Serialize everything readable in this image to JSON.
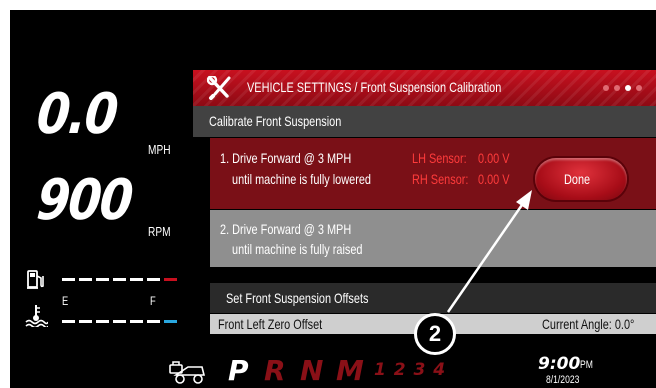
{
  "gauges": {
    "speed_value": "0.0",
    "speed_unit": "MPH",
    "rpm_value": "900",
    "rpm_unit": "RPM",
    "fuel_empty_label": "E",
    "fuel_full_label": "F"
  },
  "header": {
    "title": "VEHICLE SETTINGS / Front Suspension Calibration",
    "page_dots": 4,
    "active_page": 3
  },
  "calibration": {
    "section_title": "Calibrate Front Suspension",
    "step1_line1": "1. Drive Forward @ 3 MPH",
    "step1_line2": "until machine is fully lowered",
    "lh_sensor_label": "LH Sensor:",
    "lh_sensor_value": "0.00 V",
    "rh_sensor_label": "RH Sensor:",
    "rh_sensor_value": "0.00 V",
    "done_label": "Done",
    "step2_line1": "2. Drive Forward @ 3 MPH",
    "step2_line2": "until machine is fully raised"
  },
  "offsets": {
    "section_title": "Set Front Suspension Offsets",
    "row_label": "Front Left Zero Offset",
    "row_value": "Current Angle: 0.0°"
  },
  "status_bar": {
    "gears": [
      "P",
      "R",
      "N",
      "M"
    ],
    "selected_gear": "P",
    "manual_gears": "1 2 3 4",
    "time": "9:00",
    "time_suffix": "PM",
    "date": "8/1/2023"
  },
  "callout": {
    "number": "2"
  },
  "colors": {
    "accent_red": "#c8101f",
    "sensor_red": "#ff3b3b",
    "fuel_marker": "#c8101f",
    "temp_marker": "#2aa8e0"
  },
  "icons": [
    "wrench-screwdriver-icon",
    "fuel-pump-icon",
    "coolant-temp-icon",
    "steering-lock-icon"
  ]
}
